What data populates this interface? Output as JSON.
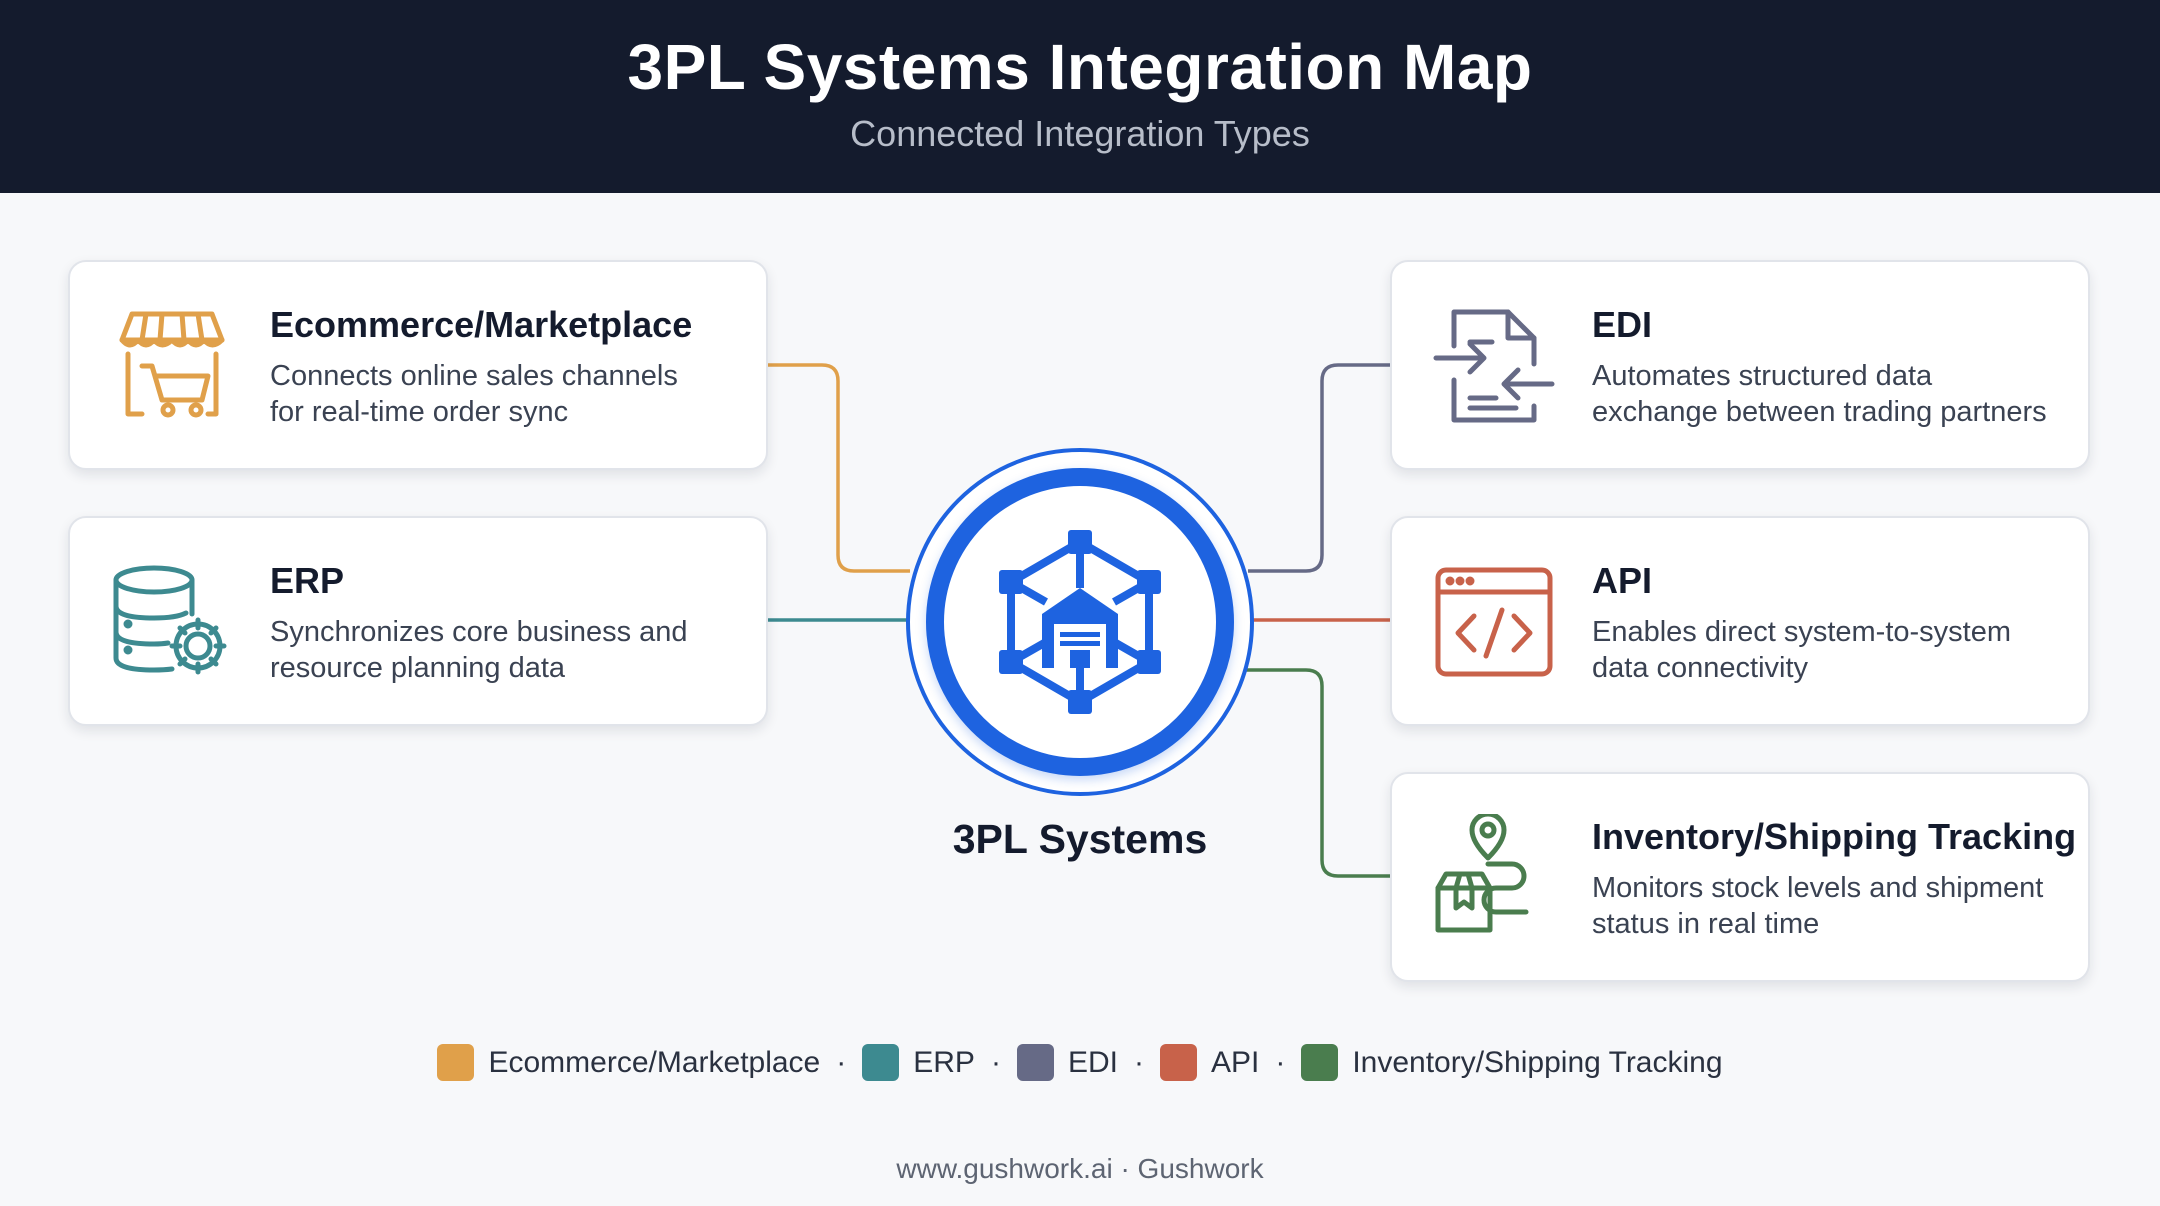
{
  "header": {
    "title": "3PL Systems Integration Map",
    "subtitle": "Connected Integration Types"
  },
  "hub": {
    "label": "3PL Systems",
    "icon": "network-warehouse-icon",
    "color": "#1e63e0"
  },
  "cards": [
    {
      "id": "ecommerce",
      "title": "Ecommerce/Marketplace",
      "line1": "Connects online sales channels",
      "line2": "for real-time order sync",
      "icon": "storefront-cart-icon",
      "color": "#e0a04a"
    },
    {
      "id": "erp",
      "title": "ERP",
      "line1": "Synchronizes core business and",
      "line2": "resource planning data",
      "icon": "database-gear-icon",
      "color": "#3d8a90"
    },
    {
      "id": "edi",
      "title": "EDI",
      "line1": "Automates structured data",
      "line2": "exchange between trading partners",
      "icon": "document-exchange-icon",
      "color": "#666a86"
    },
    {
      "id": "api",
      "title": "API",
      "line1": "Enables direct system-to-system",
      "line2": "data connectivity",
      "icon": "code-window-icon",
      "color": "#c8624a"
    },
    {
      "id": "tracking",
      "title": "Inventory/Shipping Tracking",
      "line1": "Monitors stock levels and shipment",
      "line2": "status in real time",
      "icon": "package-location-icon",
      "color": "#4a7d4e"
    }
  ],
  "legend": [
    {
      "label": "Ecommerce/Marketplace",
      "color": "#e0a04a"
    },
    {
      "label": "ERP",
      "color": "#3d8a90"
    },
    {
      "label": "EDI",
      "color": "#666a86"
    },
    {
      "label": "API",
      "color": "#c8624a"
    },
    {
      "label": "Inventory/Shipping Tracking",
      "color": "#4a7d4e"
    }
  ],
  "legend_separator": "·",
  "footer": "www.gushwork.ai · Gushwork"
}
